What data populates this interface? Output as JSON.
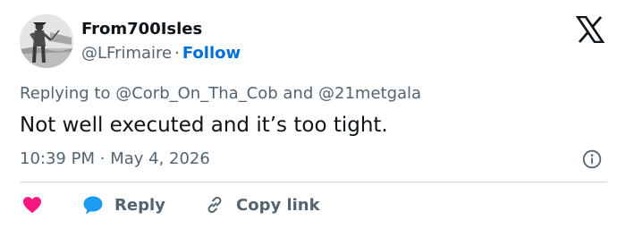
{
  "author": {
    "display_name": "From700Isles",
    "handle": "@LFrimaire",
    "separator": "·",
    "follow_label": "Follow"
  },
  "reply_context": {
    "prefix": "Replying to",
    "mention_1": "@Corb_On_Tha_Cob",
    "joiner": "and",
    "mention_2": "@21metgala"
  },
  "tweet": {
    "text": "Not well executed and it’s too tight.",
    "time": "10:39 PM",
    "separator": "·",
    "date": "May 4, 2026"
  },
  "actions": {
    "reply_label": "Reply",
    "copy_link_label": "Copy link"
  },
  "colors": {
    "text_primary": "#0f1419",
    "text_secondary": "#536471",
    "link": "#006fd6",
    "like_heart": "#f91880",
    "reply_bubble": "#1d9bf0",
    "divider": "#cfd9de"
  },
  "icons": {
    "brand": "x-logo-icon",
    "info": "info-icon",
    "like": "heart-icon",
    "reply": "speech-bubble-icon",
    "copy_link": "link-icon"
  }
}
